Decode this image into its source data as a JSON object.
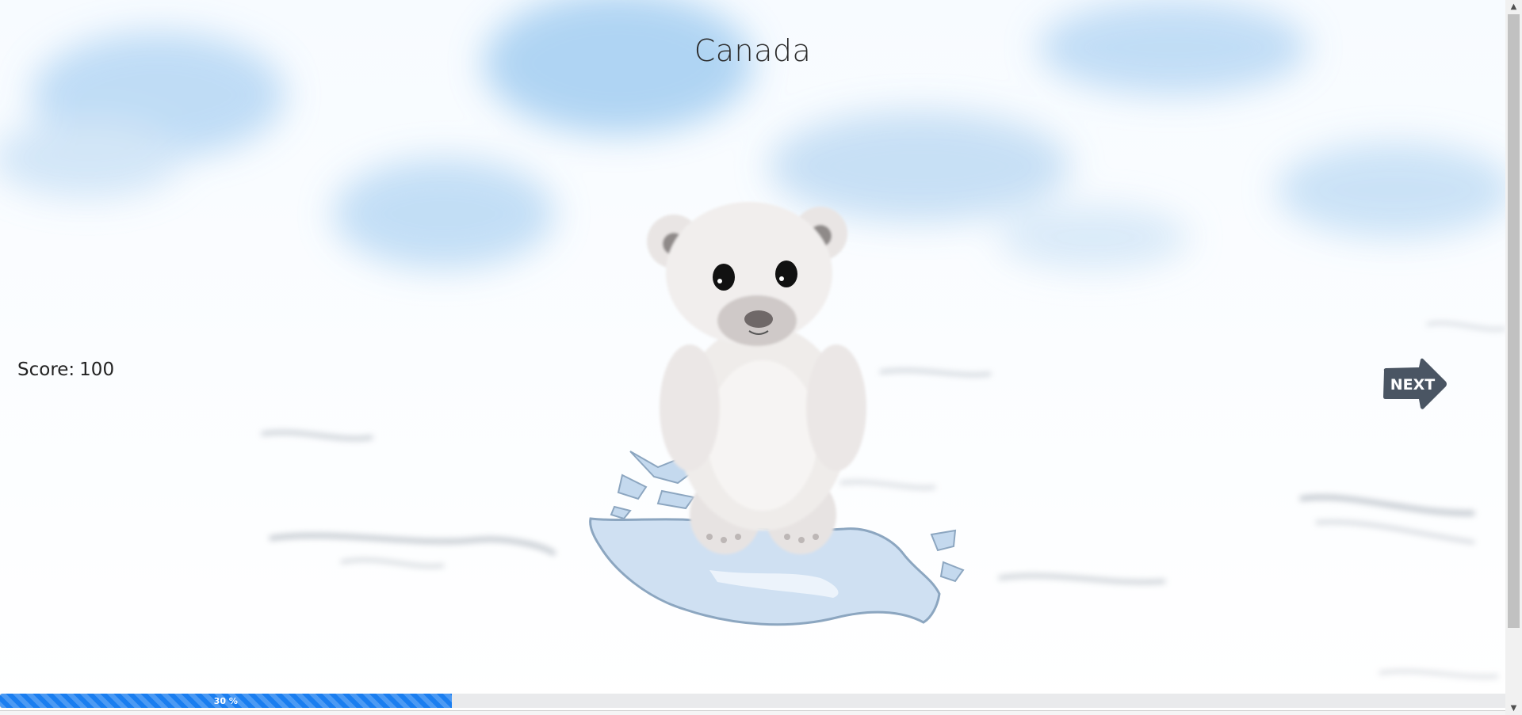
{
  "game": {
    "country": "Canada",
    "score_label": "Score:",
    "score_value": "100",
    "next_button_label": "NEXT",
    "progress": {
      "value": 0.3,
      "label": "30 %"
    }
  },
  "colors": {
    "progress_fill": "#1a7ef0",
    "next_button": "#4a5563",
    "title_text": "#2b2b2b"
  },
  "icons": {
    "scroll_up": "▲",
    "scroll_down": "▼"
  }
}
